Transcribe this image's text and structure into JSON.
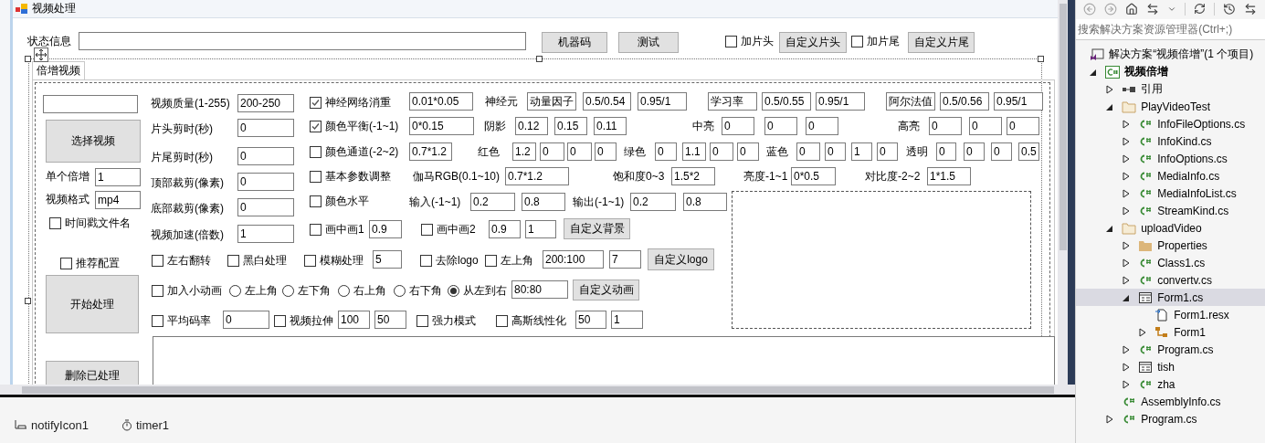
{
  "form": {
    "title": "视频处理",
    "header_controls": [
      {
        "kind": "label",
        "text": "状态信息"
      },
      {
        "kind": "field"
      },
      {
        "kind": "button",
        "text": "机器码"
      },
      {
        "kind": "button",
        "text": "测试"
      },
      {
        "kind": "checkbox",
        "text": "加片头",
        "checked": false
      },
      {
        "kind": "button",
        "text": "自定义片头"
      },
      {
        "kind": "checkbox",
        "text": "加片尾",
        "checked": false
      },
      {
        "kind": "button",
        "text": "自定义片尾"
      }
    ],
    "tab": {
      "label": "倍增视频",
      "selected": true,
      "controls": [
        {
          "kind": "field"
        },
        {
          "kind": "button",
          "text": "选择视频"
        },
        {
          "kind": "label",
          "text": "单个倍增"
        },
        {
          "kind": "field",
          "value": "1"
        },
        {
          "kind": "label",
          "text": "视频格式"
        },
        {
          "kind": "field",
          "value": "mp4"
        },
        {
          "kind": "checkbox",
          "text": "时间戳文件名",
          "checked": false
        },
        {
          "kind": "checkbox",
          "text": "推荐配置",
          "checked": false
        },
        {
          "kind": "button",
          "text": "开始处理"
        },
        {
          "kind": "button",
          "text": "删除已处理"
        },
        {
          "kind": "label",
          "text": "视频质量(1-255)"
        },
        {
          "kind": "field",
          "value": "200-250"
        },
        {
          "kind": "label",
          "text": "片头剪时(秒)"
        },
        {
          "kind": "field",
          "value": "0"
        },
        {
          "kind": "label",
          "text": "片尾剪时(秒)"
        },
        {
          "kind": "field",
          "value": "0"
        },
        {
          "kind": "label",
          "text": "顶部裁剪(像素)"
        },
        {
          "kind": "field",
          "value": "0"
        },
        {
          "kind": "label",
          "text": "底部裁剪(像素)"
        },
        {
          "kind": "field",
          "value": "0"
        },
        {
          "kind": "label",
          "text": "视频加速(倍数)"
        },
        {
          "kind": "field",
          "value": "1"
        },
        {
          "kind": "checkbox",
          "text": "神经网络消重",
          "checked": true
        },
        {
          "kind": "field",
          "value": "0.01*0.05"
        },
        {
          "kind": "label",
          "text": "神经元"
        },
        {
          "kind": "field",
          "value": "动量因子"
        },
        {
          "kind": "field",
          "value": "0.5/0.54"
        },
        {
          "kind": "field",
          "value": "0.95/1"
        },
        {
          "kind": "field",
          "value": "学习率"
        },
        {
          "kind": "field",
          "value": "0.5/0.55"
        },
        {
          "kind": "field",
          "value": "0.95/1"
        },
        {
          "kind": "field",
          "value": "阿尔法值"
        },
        {
          "kind": "field",
          "value": "0.5/0.56"
        },
        {
          "kind": "field",
          "value": "0.95/1"
        },
        {
          "kind": "checkbox",
          "text": "颜色平衡(-1~1)",
          "checked": true
        },
        {
          "kind": "field",
          "value": "0*0.15"
        },
        {
          "kind": "label",
          "text": "阴影"
        },
        {
          "kind": "field",
          "value": "0.12"
        },
        {
          "kind": "field",
          "value": "0.15"
        },
        {
          "kind": "field",
          "value": "0.11"
        },
        {
          "kind": "label",
          "text": "中亮"
        },
        {
          "kind": "field",
          "value": "0"
        },
        {
          "kind": "field",
          "value": "0"
        },
        {
          "kind": "field",
          "value": "0"
        },
        {
          "kind": "label",
          "text": "高亮"
        },
        {
          "kind": "field",
          "value": "0"
        },
        {
          "kind": "field",
          "value": "0"
        },
        {
          "kind": "field",
          "value": "0"
        },
        {
          "kind": "checkbox",
          "text": "颜色通道(-2~2)",
          "checked": false
        },
        {
          "kind": "field",
          "value": "0.7*1.2"
        },
        {
          "kind": "label",
          "text": "红色"
        },
        {
          "kind": "field",
          "value": "1.2"
        },
        {
          "kind": "field",
          "value": "0"
        },
        {
          "kind": "field",
          "value": "0"
        },
        {
          "kind": "field",
          "value": "0"
        },
        {
          "kind": "label",
          "text": "绿色"
        },
        {
          "kind": "field",
          "value": "0"
        },
        {
          "kind": "field",
          "value": "1.1"
        },
        {
          "kind": "field",
          "value": "0"
        },
        {
          "kind": "field",
          "value": "0"
        },
        {
          "kind": "label",
          "text": "蓝色"
        },
        {
          "kind": "field",
          "value": "0"
        },
        {
          "kind": "field",
          "value": "0"
        },
        {
          "kind": "field",
          "value": "1"
        },
        {
          "kind": "field",
          "value": "0"
        },
        {
          "kind": "label",
          "text": "透明"
        },
        {
          "kind": "field",
          "value": "0"
        },
        {
          "kind": "field",
          "value": "0"
        },
        {
          "kind": "field",
          "value": "0"
        },
        {
          "kind": "field",
          "value": "0.5"
        },
        {
          "kind": "checkbox",
          "text": "基本参数调整",
          "checked": false
        },
        {
          "kind": "label",
          "text": "伽马RGB(0.1~10)"
        },
        {
          "kind": "field",
          "value": "0.7*1.2"
        },
        {
          "kind": "label",
          "text": "饱和度0~3"
        },
        {
          "kind": "field",
          "value": "1.5*2"
        },
        {
          "kind": "label",
          "text": "亮度-1~1"
        },
        {
          "kind": "field",
          "value": "0*0.5"
        },
        {
          "kind": "label",
          "text": "对比度-2~2"
        },
        {
          "kind": "field",
          "value": "1*1.5"
        },
        {
          "kind": "checkbox",
          "text": "颜色水平",
          "checked": false
        },
        {
          "kind": "label",
          "text": "输入(-1~1)"
        },
        {
          "kind": "field",
          "value": "0.2"
        },
        {
          "kind": "field",
          "value": "0.8"
        },
        {
          "kind": "label",
          "text": "输出(-1~1)"
        },
        {
          "kind": "field",
          "value": "0.2"
        },
        {
          "kind": "field",
          "value": "0.8"
        },
        {
          "kind": "checkbox",
          "text": "画中画1",
          "checked": false
        },
        {
          "kind": "field",
          "value": "0.9"
        },
        {
          "kind": "checkbox",
          "text": "画中画2",
          "checked": false
        },
        {
          "kind": "field",
          "value": "0.9"
        },
        {
          "kind": "field",
          "value": "1"
        },
        {
          "kind": "button",
          "text": "自定义背景"
        },
        {
          "kind": "checkbox",
          "text": "左右翻转",
          "checked": false
        },
        {
          "kind": "checkbox",
          "text": "黑白处理",
          "checked": false
        },
        {
          "kind": "checkbox",
          "text": "模糊处理",
          "checked": false
        },
        {
          "kind": "field",
          "value": "5"
        },
        {
          "kind": "checkbox",
          "text": "去除logo",
          "checked": false
        },
        {
          "kind": "checkbox",
          "text": "左上角",
          "checked": false
        },
        {
          "kind": "field",
          "value": "200:100"
        },
        {
          "kind": "field",
          "value": "7"
        },
        {
          "kind": "button",
          "text": "自定义logo"
        },
        {
          "kind": "checkbox",
          "text": "加入小动画",
          "checked": false
        },
        {
          "kind": "radio",
          "text": "左上角",
          "selected": false
        },
        {
          "kind": "radio",
          "text": "左下角",
          "selected": false
        },
        {
          "kind": "radio",
          "text": "右上角",
          "selected": false
        },
        {
          "kind": "radio",
          "text": "右下角",
          "selected": false
        },
        {
          "kind": "radio",
          "text": "从左到右",
          "selected": true
        },
        {
          "kind": "field",
          "value": "80:80"
        },
        {
          "kind": "button",
          "text": "自定义动画"
        },
        {
          "kind": "checkbox",
          "text": "平均码率",
          "checked": false
        },
        {
          "kind": "field",
          "value": "0"
        },
        {
          "kind": "checkbox",
          "text": "视频拉伸",
          "checked": false
        },
        {
          "kind": "field",
          "value": "100"
        },
        {
          "kind": "field",
          "value": "50"
        },
        {
          "kind": "checkbox",
          "text": "强力模式",
          "checked": false
        },
        {
          "kind": "checkbox",
          "text": "高斯线性化",
          "checked": false
        },
        {
          "kind": "field",
          "value": "50"
        },
        {
          "kind": "field",
          "value": "1"
        },
        {
          "kind": "textarea"
        }
      ]
    }
  },
  "component_tray": [
    {
      "label": "notifyIcon1",
      "kind": "notify"
    },
    {
      "label": "timer1",
      "kind": "timer"
    }
  ],
  "solution_explorer": {
    "search": {
      "placeholder": "搜索解决方案资源管理器(Ctrl+;)"
    },
    "tree": [
      {
        "label": "解决方案“视频倍增”(1 个项目)",
        "kind": "solution",
        "selected": false,
        "children": [
          {
            "label": "视频倍增",
            "kind": "project",
            "expanded": true,
            "selected": false,
            "children": [
              {
                "label": "引用",
                "kind": "references",
                "expanded": false,
                "selected": false
              },
              {
                "label": "PlayVideoTest",
                "kind": "folder",
                "expanded": true,
                "selected": false,
                "children": [
                  {
                    "label": "InfoFileOptions.cs",
                    "kind": "cs",
                    "expanded": false,
                    "selected": false
                  },
                  {
                    "label": "InfoKind.cs",
                    "kind": "cs",
                    "expanded": false,
                    "selected": false
                  },
                  {
                    "label": "InfoOptions.cs",
                    "kind": "cs",
                    "expanded": false,
                    "selected": false
                  },
                  {
                    "label": "MediaInfo.cs",
                    "kind": "cs",
                    "expanded": false,
                    "selected": false
                  },
                  {
                    "label": "MediaInfoList.cs",
                    "kind": "cs",
                    "expanded": false,
                    "selected": false
                  },
                  {
                    "label": "StreamKind.cs",
                    "kind": "cs",
                    "expanded": false,
                    "selected": false
                  }
                ]
              },
              {
                "label": "uploadVideo",
                "kind": "folder",
                "expanded": true,
                "selected": false,
                "children": [
                  {
                    "label": "Properties",
                    "kind": "properties",
                    "expanded": false,
                    "selected": false
                  },
                  {
                    "label": "Class1.cs",
                    "kind": "cs",
                    "expanded": false,
                    "selected": false
                  },
                  {
                    "label": "convertv.cs",
                    "kind": "cs",
                    "expanded": false,
                    "selected": false
                  },
                  {
                    "label": "Form1.cs",
                    "kind": "form",
                    "expanded": true,
                    "selected": true,
                    "children": [
                      {
                        "label": "Form1.resx",
                        "kind": "resx",
                        "selected": false
                      },
                      {
                        "label": "Form1",
                        "kind": "class",
                        "expanded": false,
                        "selected": false
                      }
                    ]
                  },
                  {
                    "label": "Program.cs",
                    "kind": "cs",
                    "expanded": false,
                    "selected": false
                  },
                  {
                    "label": "tish",
                    "kind": "form",
                    "expanded": false,
                    "selected": false
                  },
                  {
                    "label": "zha",
                    "kind": "cs",
                    "expanded": false,
                    "selected": false
                  }
                ]
              },
              {
                "label": "AssemblyInfo.cs",
                "kind": "cs",
                "selected": false
              },
              {
                "label": "Program.cs",
                "kind": "cs",
                "expanded": false,
                "selected": false
              }
            ]
          }
        ]
      }
    ]
  }
}
